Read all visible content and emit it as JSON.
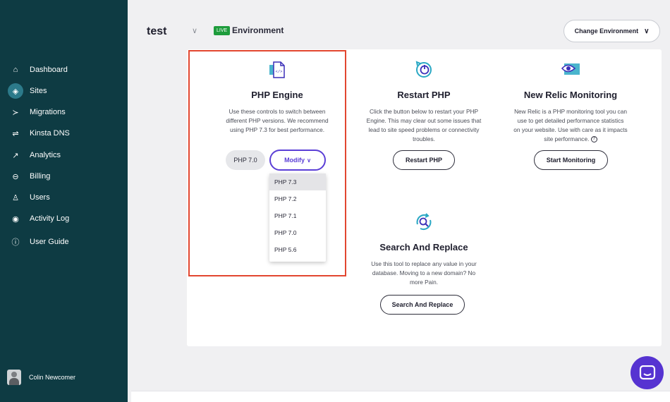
{
  "sidebar": {
    "items": [
      {
        "label": "Dashboard",
        "icon": "home-icon",
        "glyph": "⌂"
      },
      {
        "label": "Sites",
        "icon": "layers-icon",
        "glyph": "◈"
      },
      {
        "label": "Migrations",
        "icon": "migrate-icon",
        "glyph": "≻"
      },
      {
        "label": "Kinsta DNS",
        "icon": "dns-icon",
        "glyph": "⇌"
      },
      {
        "label": "Analytics",
        "icon": "trend-icon",
        "glyph": "↗"
      },
      {
        "label": "Billing",
        "icon": "billing-icon",
        "glyph": "⊖"
      },
      {
        "label": "Users",
        "icon": "add-user-icon",
        "glyph": "♙"
      },
      {
        "label": "Activity Log",
        "icon": "eye-icon",
        "glyph": "◉"
      },
      {
        "label": "User Guide",
        "icon": "info-icon",
        "glyph": "ⓘ"
      }
    ],
    "user_name": "Colin Newcomer"
  },
  "header": {
    "site_name": "test",
    "live_badge": "LIVE",
    "environment": "Environment",
    "change_env_label": "Change Environment"
  },
  "php": {
    "title": "PHP Engine",
    "desc_lines": [
      "Use these controls to switch between",
      "different PHP versions. We recommend",
      "using PHP 7.3 for best performance."
    ],
    "current_version": "PHP 7.0",
    "modify_label": "Modify",
    "options": [
      "PHP 7.3",
      "PHP 7.2",
      "PHP 7.1",
      "PHP 7.0",
      "PHP 5.6"
    ]
  },
  "restart": {
    "title": "Restart PHP",
    "desc_lines": [
      "Click the button below to restart your PHP",
      "Engine. This may clear out some issues that",
      "lead to site speed problems or connectivity",
      "troubles."
    ],
    "button": "Restart PHP"
  },
  "relic": {
    "title": "New Relic Monitoring",
    "desc_lines": [
      "New Relic is a PHP monitoring tool you can",
      "use to get detailed performance statistics",
      "on your website. Use with care as it impacts",
      "site performance."
    ],
    "button": "Start Monitoring"
  },
  "search": {
    "title": "Search And Replace",
    "desc_lines": [
      "Use this tool to replace any value in your",
      "database. Moving to a new domain? No",
      "more Pain."
    ],
    "button": "Search And Replace"
  },
  "colors": {
    "sidebar_bg": "#0e3b43",
    "accent_purple": "#5b3fd6",
    "live_green": "#1e9c3c",
    "highlight_red": "#e2462f",
    "icon_teal": "#2aa8c4"
  }
}
